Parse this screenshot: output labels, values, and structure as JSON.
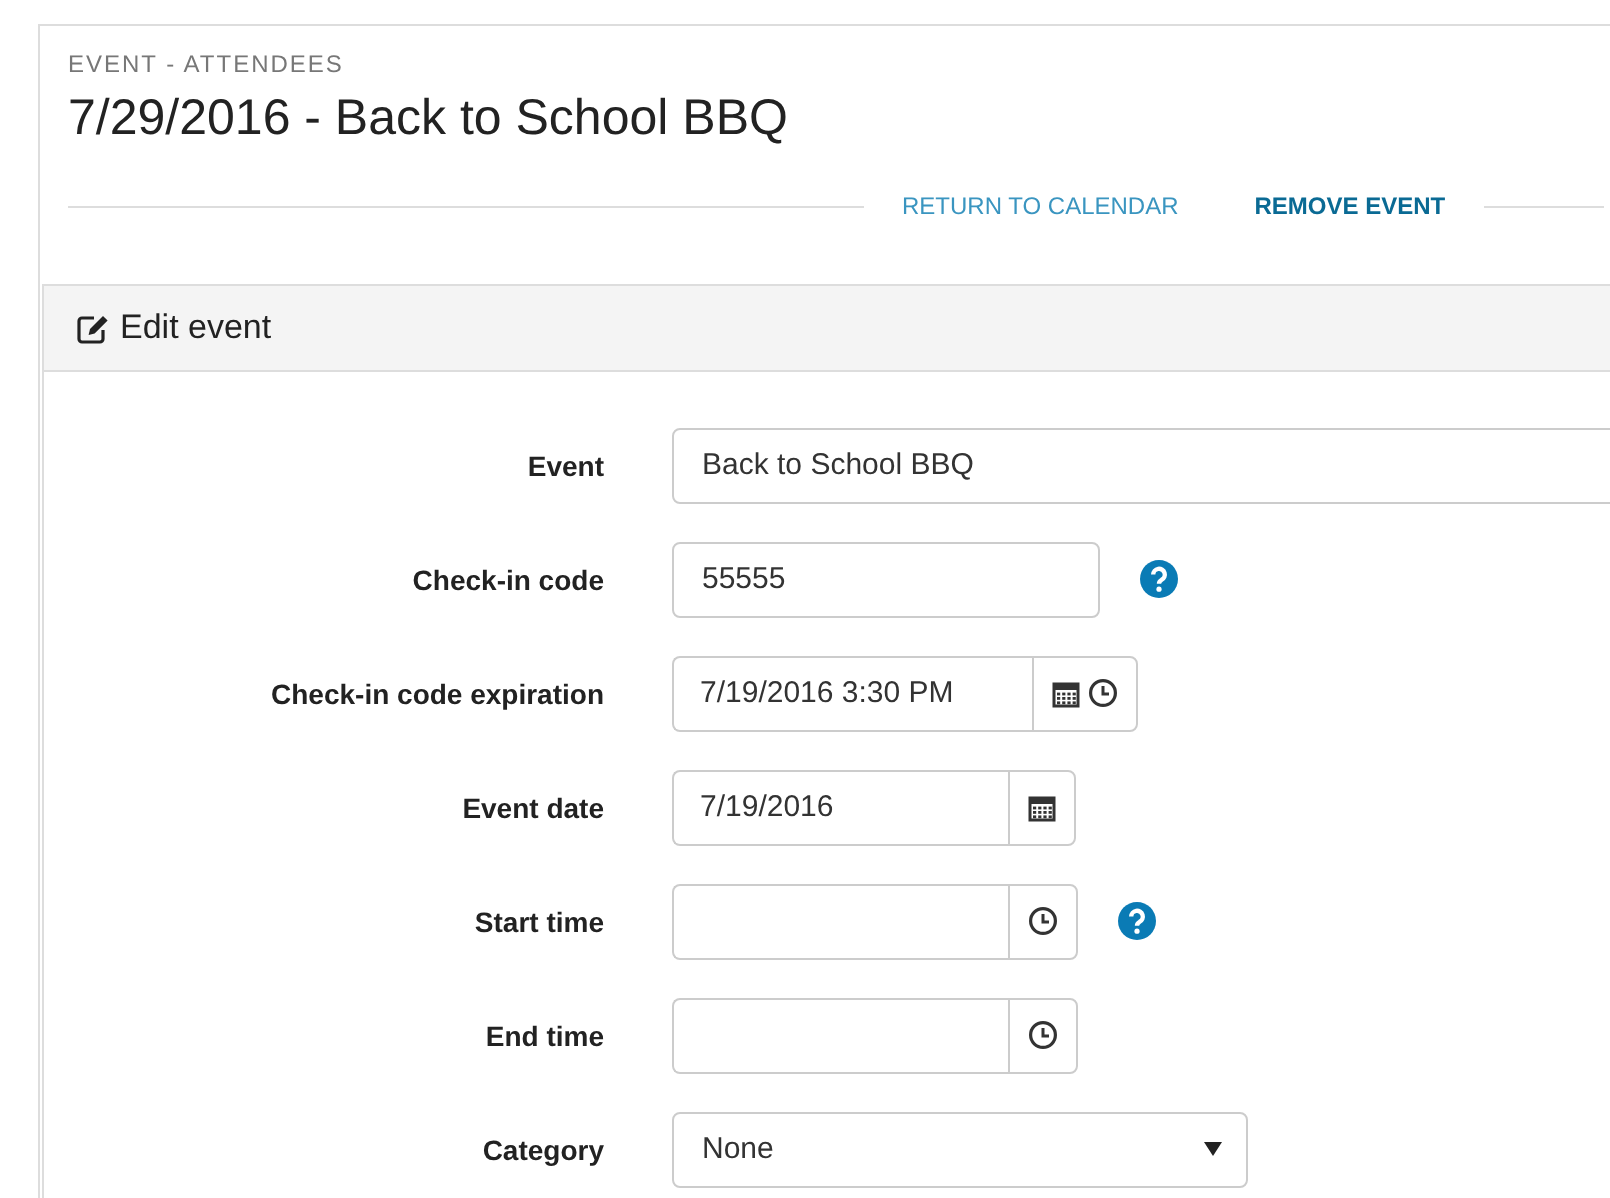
{
  "breadcrumb": "EVENT - ATTENDEES",
  "title": "7/29/2016 - Back to School BBQ",
  "actions": [
    {
      "label": "RETURN TO CALENDAR",
      "strong": false
    },
    {
      "label": "REMOVE EVENT",
      "strong": true
    }
  ],
  "panel": {
    "title": "Edit event"
  },
  "fields": [
    {
      "label": "Event",
      "kind": "wide_text",
      "value": "Back to School BBQ",
      "help": false
    },
    {
      "label": "Check-in code",
      "kind": "short_text",
      "value": "55555",
      "help": true
    },
    {
      "label": "Check-in code expiration",
      "kind": "datetime",
      "value": "7/19/2016 3:30 PM",
      "help": false
    },
    {
      "label": "Event date",
      "kind": "date",
      "value": "7/19/2016",
      "help": false
    },
    {
      "label": "Start time",
      "kind": "time",
      "help": true
    },
    {
      "label": "End time",
      "kind": "time",
      "help": false
    },
    {
      "label": "Category",
      "kind": "select",
      "value": "None",
      "help": false
    }
  ]
}
